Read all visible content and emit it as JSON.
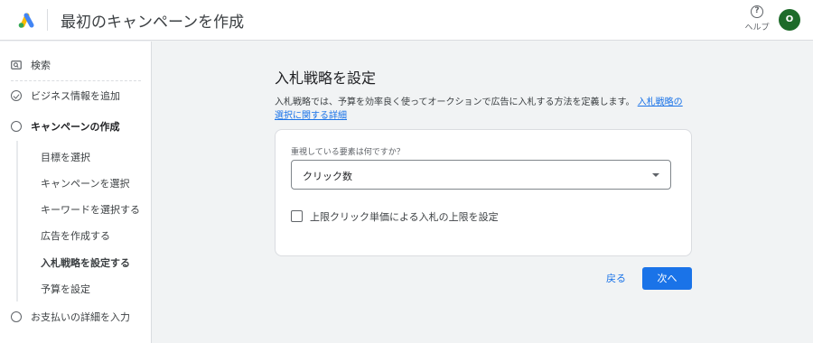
{
  "header": {
    "title": "最初のキャンペーンを作成",
    "help_label": "ヘルプ",
    "help_glyph": "?",
    "avatar_initial": "O",
    "logo_icon": "google-ads-logo",
    "brand_colors": {
      "blue": "#4285f4",
      "yellow": "#fbbc04",
      "green": "#34a853"
    }
  },
  "sidebar": {
    "search_label": "検索",
    "steps": [
      {
        "label": "ビジネス情報を追加",
        "state": "done"
      },
      {
        "label": "キャンペーンの作成",
        "state": "current"
      },
      {
        "label": "お支払いの詳細を入力",
        "state": "todo"
      }
    ],
    "substeps": [
      {
        "label": "目標を選択"
      },
      {
        "label": "キャンペーンを選択"
      },
      {
        "label": "キーワードを選択する"
      },
      {
        "label": "広告を作成する"
      },
      {
        "label": "入札戦略を設定する",
        "active": true
      },
      {
        "label": "予算を設定"
      }
    ]
  },
  "main": {
    "title": "入札戦略を設定",
    "description": "入札戦略では、予算を効率良く使ってオークションで広告に入札する方法を定義します。",
    "learn_more_link": "入札戦略の選択に関する詳細",
    "focus_label": "重視している要素は何ですか？",
    "focus_value": "クリック数",
    "max_cpc_checkbox_label": "上限クリック単価による入札の上限を設定",
    "max_cpc_checked": false,
    "back_label": "戻る",
    "next_label": "次へ"
  },
  "colors": {
    "accent": "#1a73e8",
    "avatar": "#1e6b2a"
  }
}
